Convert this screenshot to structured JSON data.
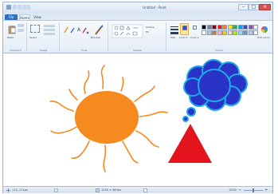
{
  "window": {
    "title": "Untitled - Paint",
    "controls": {
      "minimize": "–",
      "maximize": "□",
      "close": "×"
    }
  },
  "tabs": {
    "file": "File",
    "home": "Home",
    "view": "View"
  },
  "ribbon": {
    "groups": {
      "clipboard": "Clipboard",
      "image": "Image",
      "tools": "Tools",
      "shapes": "Shapes",
      "colors": "Colors"
    },
    "buttons": {
      "paste": "Paste",
      "select": "Select",
      "brushes": "Brushes",
      "outline": "Outline",
      "fill": "Fill",
      "size": "Size",
      "color1": "Color 1",
      "color2": "Color 2",
      "edit_colors": "Edit colors"
    },
    "palette": [
      "#000000",
      "#7f7f7f",
      "#880015",
      "#ed1c24",
      "#ff7f27",
      "#fff200",
      "#22b14c",
      "#00a2e8",
      "#3f48cc",
      "#a349a4",
      "#ffffff",
      "#ffffff",
      "#c3c3c3",
      "#b97a57",
      "#ffaec9",
      "#ffc90e",
      "#efe4b0",
      "#b5e61d",
      "#99d9ea",
      "#7092be",
      "#c8bfe7",
      "#ffffff"
    ],
    "active_color1": "#3f48cc",
    "active_color2": "#ffffff",
    "accent": "#f5c542"
  },
  "canvas": {
    "sun_color": "#f58a1f",
    "cloud_fill": "#2a33c8",
    "cloud_outline": "#1fa8e8",
    "triangle_color": "#e3141b"
  },
  "status": {
    "cursor": "172, 111px",
    "selection": "",
    "size": "1235 × 480px",
    "zoom": "100%"
  }
}
